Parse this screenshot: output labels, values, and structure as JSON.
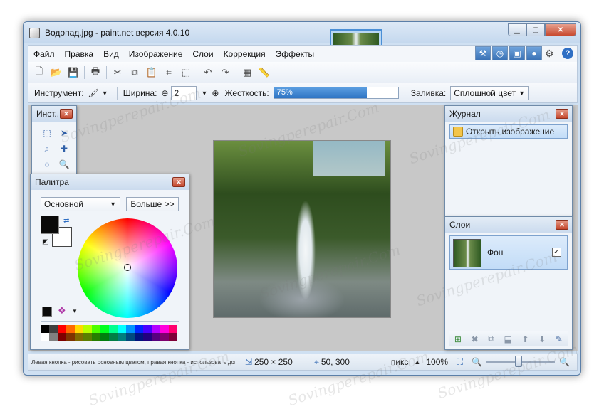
{
  "window": {
    "title": "Водопад.jpg - paint.net версия 4.0.10"
  },
  "menu": [
    "Файл",
    "Правка",
    "Вид",
    "Изображение",
    "Слои",
    "Коррекция",
    "Эффекты"
  ],
  "toolbar2": {
    "tool_label": "Инструмент:",
    "width_label": "Ширина:",
    "width_value": "2",
    "hardness_label": "Жесткость:",
    "hardness_value": "75%",
    "hardness_level": 0.75,
    "fill_label": "Заливка:",
    "fill_value": "Сплошной цвет"
  },
  "tools_panel": {
    "title": "Инст..."
  },
  "palette_panel": {
    "title": "Палитра",
    "mode_select": "Основной",
    "more_button": "Больше >>",
    "primary_color": "#0a0a0a",
    "secondary_color": "#ffffff",
    "colors_row1": [
      "#000000",
      "#404040",
      "#ff0000",
      "#ff6a00",
      "#ffd800",
      "#b6ff00",
      "#4cff00",
      "#00ff21",
      "#00ff90",
      "#00ffff",
      "#0094ff",
      "#0026ff",
      "#4800ff",
      "#b200ff",
      "#ff00dc",
      "#ff006e"
    ],
    "colors_row2": [
      "#ffffff",
      "#808080",
      "#7f0000",
      "#7f3300",
      "#7f6a00",
      "#5b7f00",
      "#267f00",
      "#007f0e",
      "#007f46",
      "#007f7f",
      "#004a7f",
      "#00137f",
      "#21007f",
      "#57007f",
      "#7f006e",
      "#7f0037"
    ]
  },
  "history_panel": {
    "title": "Журнал",
    "items": [
      "Открыть изображение"
    ]
  },
  "layers_panel": {
    "title": "Слои",
    "layers": [
      {
        "name": "Фон",
        "visible": true
      }
    ]
  },
  "status": {
    "hint": "Левая кнопка - рисовать основным цветом, правая кнопка - использовать дополни...",
    "size": "250 × 250",
    "cursor": "50, 300",
    "units": "пикс",
    "zoom": "100%"
  },
  "watermark": "Sovingperepair.Com"
}
